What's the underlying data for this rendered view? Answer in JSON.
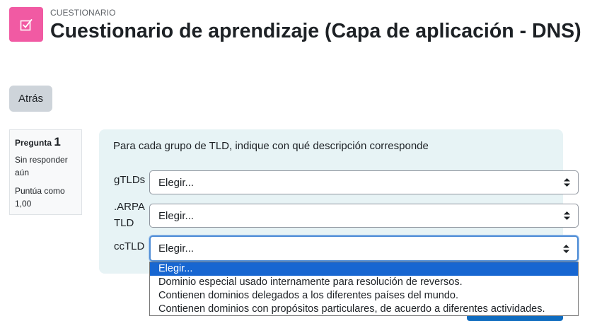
{
  "header": {
    "kicker": "CUESTIONARIO",
    "title": "Cuestionario de aprendizaje (Capa de aplicación - DNS)",
    "icon": "quiz-checkbox-icon",
    "icon_color": "#f15aa3"
  },
  "nav": {
    "back_label": "Atrás"
  },
  "question_info": {
    "title_prefix": "Pregunta",
    "number": "1",
    "state": "Sin responder aún",
    "grade": "Puntúa como 1,00"
  },
  "question": {
    "text": "Para cada grupo de TLD, indique con qué descripción corresponde",
    "rows": [
      {
        "label": "gTLDs",
        "selected": "Elegir..."
      },
      {
        "label": ".ARPA TLD",
        "selected": "Elegir..."
      },
      {
        "label": "ccTLD",
        "selected": "Elegir..."
      }
    ]
  },
  "dropdown": {
    "options": [
      "Elegir...",
      "Dominio especial usado internamente para resolución de reversos.",
      "Contienen dominios delegados a los diferentes países del mundo.",
      "Contienen dominios con propósitos particulares, de acuerdo a diferentes actividades."
    ],
    "highlighted_index": 0
  },
  "colors": {
    "accent": "#1766d1",
    "formulation_bg": "#e7f3f5",
    "focus_border": "#4f8dd6"
  }
}
